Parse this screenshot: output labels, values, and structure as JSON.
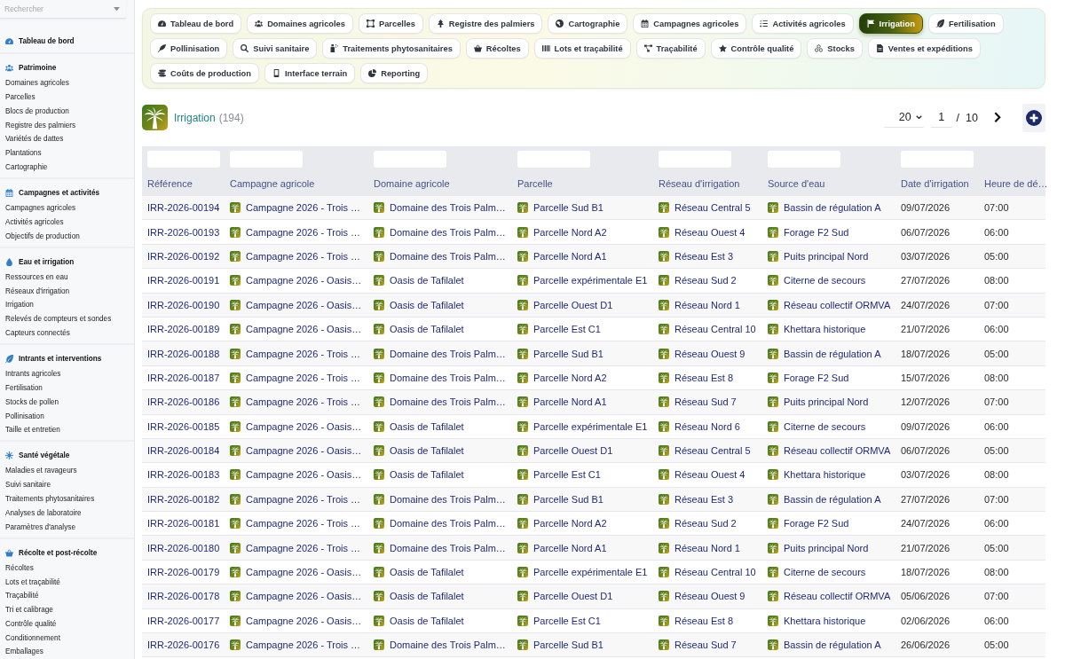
{
  "sidebar": {
    "search": {
      "placeholder": "Rechercher"
    },
    "sections": [
      {
        "title": "Tableau de bord"
      },
      {
        "title": "Patrimoine",
        "items": [
          "Domaines agricoles",
          "Parcelles",
          "Blocs de production",
          "Registre des palmiers",
          "Variétés de dattes",
          "Plantations",
          "Cartographie"
        ]
      },
      {
        "title": "Campagnes et activités",
        "items": [
          "Campagnes agricoles",
          "Activités agricoles",
          "Objectifs de production"
        ]
      },
      {
        "title": "Eau et irrigation",
        "items": [
          "Ressources en eau",
          "Réseaux d'irrigation",
          "Irrigation",
          "Relevés de compteurs et sondes",
          "Capteurs connectés"
        ]
      },
      {
        "title": "Intrants et interventions",
        "items": [
          "Intrants agricoles",
          "Fertilisation",
          "Stocks de pollen",
          "Pollinisation",
          "Taille et entretien"
        ]
      },
      {
        "title": "Santé végétale",
        "items": [
          "Maladies et ravageurs",
          "Suivi sanitaire",
          "Traitements phytosanitaires",
          "Analyses de laboratoire",
          "Paramètres d'analyse"
        ]
      },
      {
        "title": "Récolte et post-récolte",
        "items": [
          "Récoltes",
          "Lots et traçabilité",
          "Traçabilité",
          "Tri et calibrage",
          "Contrôle qualité",
          "Conditionnement",
          "Emballages"
        ]
      }
    ]
  },
  "modules": [
    {
      "label": "Tableau de bord",
      "selected": false
    },
    {
      "label": "Domaines agricoles",
      "selected": false
    },
    {
      "label": "Parcelles",
      "selected": false
    },
    {
      "label": "Registre des palmiers",
      "selected": false
    },
    {
      "label": "Cartographie",
      "selected": false
    },
    {
      "label": "Campagnes agricoles",
      "selected": false
    },
    {
      "label": "Activités agricoles",
      "selected": false
    },
    {
      "label": "Irrigation",
      "selected": true
    },
    {
      "label": "Fertilisation",
      "selected": false
    },
    {
      "label": "Pollinisation",
      "selected": false
    },
    {
      "label": "Suivi sanitaire",
      "selected": false
    },
    {
      "label": "Traitements phytosanitaires",
      "selected": false
    },
    {
      "label": "Récoltes",
      "selected": false
    },
    {
      "label": "Lots et traçabilité",
      "selected": false
    },
    {
      "label": "Traçabilité",
      "selected": false
    },
    {
      "label": "Contrôle qualité",
      "selected": false
    },
    {
      "label": "Stocks",
      "selected": false
    },
    {
      "label": "Ventes et expéditions",
      "selected": false
    },
    {
      "label": "Coûts de production",
      "selected": false
    },
    {
      "label": "Interface terrain",
      "selected": false
    },
    {
      "label": "Reporting",
      "selected": false
    }
  ],
  "page": {
    "title": "Irrigation",
    "count": "(194)"
  },
  "pagination": {
    "page_size": "20",
    "page": "1",
    "separator": "/",
    "total_pages": "10"
  },
  "table": {
    "columns": [
      {
        "label": "Référence",
        "kind": "reference",
        "filter": true
      },
      {
        "label": "Campagne agricole",
        "kind": "entity",
        "filter": true
      },
      {
        "label": "Domaine agricole",
        "kind": "entity",
        "filter": true
      },
      {
        "label": "Parcelle",
        "kind": "entity",
        "filter": true
      },
      {
        "label": "Réseau d'irrigation",
        "kind": "entity",
        "filter": true
      },
      {
        "label": "Source d'eau",
        "kind": "entity",
        "filter": true
      },
      {
        "label": "Date d'irrigation",
        "kind": "text",
        "filter": true
      },
      {
        "label": "Heure de dé…",
        "kind": "text",
        "filter": false
      }
    ],
    "rows": [
      [
        "IRR-2026-00194",
        "Campagne 2026 - Trois …",
        "Domaine des Trois Palm…",
        "Parcelle Sud B1",
        "Réseau Central 5",
        "Bassin de régulation A",
        "09/07/2026",
        "07:00"
      ],
      [
        "IRR-2026-00193",
        "Campagne 2026 - Trois …",
        "Domaine des Trois Palm…",
        "Parcelle Nord A2",
        "Réseau Ouest 4",
        "Forage F2 Sud",
        "06/07/2026",
        "06:00"
      ],
      [
        "IRR-2026-00192",
        "Campagne 2026 - Trois …",
        "Domaine des Trois Palm…",
        "Parcelle Nord A1",
        "Réseau Est 3",
        "Puits principal Nord",
        "03/07/2026",
        "05:00"
      ],
      [
        "IRR-2026-00191",
        "Campagne 2026 - Oasis…",
        "Oasis de Tafilalet",
        "Parcelle expérimentale E1",
        "Réseau Sud 2",
        "Citerne de secours",
        "27/07/2026",
        "08:00"
      ],
      [
        "IRR-2026-00190",
        "Campagne 2026 - Oasis…",
        "Oasis de Tafilalet",
        "Parcelle Ouest D1",
        "Réseau Nord 1",
        "Réseau collectif ORMVA",
        "24/07/2026",
        "07:00"
      ],
      [
        "IRR-2026-00189",
        "Campagne 2026 - Oasis…",
        "Oasis de Tafilalet",
        "Parcelle Est C1",
        "Réseau Central 10",
        "Khettara historique",
        "21/07/2026",
        "06:00"
      ],
      [
        "IRR-2026-00188",
        "Campagne 2026 - Trois …",
        "Domaine des Trois Palm…",
        "Parcelle Sud B1",
        "Réseau Ouest 9",
        "Bassin de régulation A",
        "18/07/2026",
        "05:00"
      ],
      [
        "IRR-2026-00187",
        "Campagne 2026 - Trois …",
        "Domaine des Trois Palm…",
        "Parcelle Nord A2",
        "Réseau Est 8",
        "Forage F2 Sud",
        "15/07/2026",
        "08:00"
      ],
      [
        "IRR-2026-00186",
        "Campagne 2026 - Trois …",
        "Domaine des Trois Palm…",
        "Parcelle Nord A1",
        "Réseau Sud 7",
        "Puits principal Nord",
        "12/07/2026",
        "07:00"
      ],
      [
        "IRR-2026-00185",
        "Campagne 2026 - Oasis…",
        "Oasis de Tafilalet",
        "Parcelle expérimentale E1",
        "Réseau Nord 6",
        "Citerne de secours",
        "09/07/2026",
        "06:00"
      ],
      [
        "IRR-2026-00184",
        "Campagne 2026 - Oasis…",
        "Oasis de Tafilalet",
        "Parcelle Ouest D1",
        "Réseau Central 5",
        "Réseau collectif ORMVA",
        "06/07/2026",
        "05:00"
      ],
      [
        "IRR-2026-00183",
        "Campagne 2026 - Oasis…",
        "Oasis de Tafilalet",
        "Parcelle Est C1",
        "Réseau Ouest 4",
        "Khettara historique",
        "03/07/2026",
        "08:00"
      ],
      [
        "IRR-2026-00182",
        "Campagne 2026 - Trois …",
        "Domaine des Trois Palm…",
        "Parcelle Sud B1",
        "Réseau Est 3",
        "Bassin de régulation A",
        "27/07/2026",
        "07:00"
      ],
      [
        "IRR-2026-00181",
        "Campagne 2026 - Trois …",
        "Domaine des Trois Palm…",
        "Parcelle Nord A2",
        "Réseau Sud 2",
        "Forage F2 Sud",
        "24/07/2026",
        "06:00"
      ],
      [
        "IRR-2026-00180",
        "Campagne 2026 - Trois …",
        "Domaine des Trois Palm…",
        "Parcelle Nord A1",
        "Réseau Nord 1",
        "Puits principal Nord",
        "21/07/2026",
        "05:00"
      ],
      [
        "IRR-2026-00179",
        "Campagne 2026 - Oasis…",
        "Oasis de Tafilalet",
        "Parcelle expérimentale E1",
        "Réseau Central 10",
        "Citerne de secours",
        "18/07/2026",
        "08:00"
      ],
      [
        "IRR-2026-00178",
        "Campagne 2026 - Oasis…",
        "Oasis de Tafilalet",
        "Parcelle Ouest D1",
        "Réseau Ouest 9",
        "Réseau collectif ORMVA",
        "05/06/2026",
        "07:00"
      ],
      [
        "IRR-2026-00177",
        "Campagne 2026 - Oasis…",
        "Oasis de Tafilalet",
        "Parcelle Est C1",
        "Réseau Est 8",
        "Khettara historique",
        "02/06/2026",
        "06:00"
      ],
      [
        "IRR-2026-00176",
        "Campagne 2026 - Trois …",
        "Domaine des Trois Palm…",
        "Parcelle Sud B1",
        "Réseau Sud 7",
        "Bassin de régulation A",
        "26/06/2026",
        "05:00"
      ]
    ]
  }
}
